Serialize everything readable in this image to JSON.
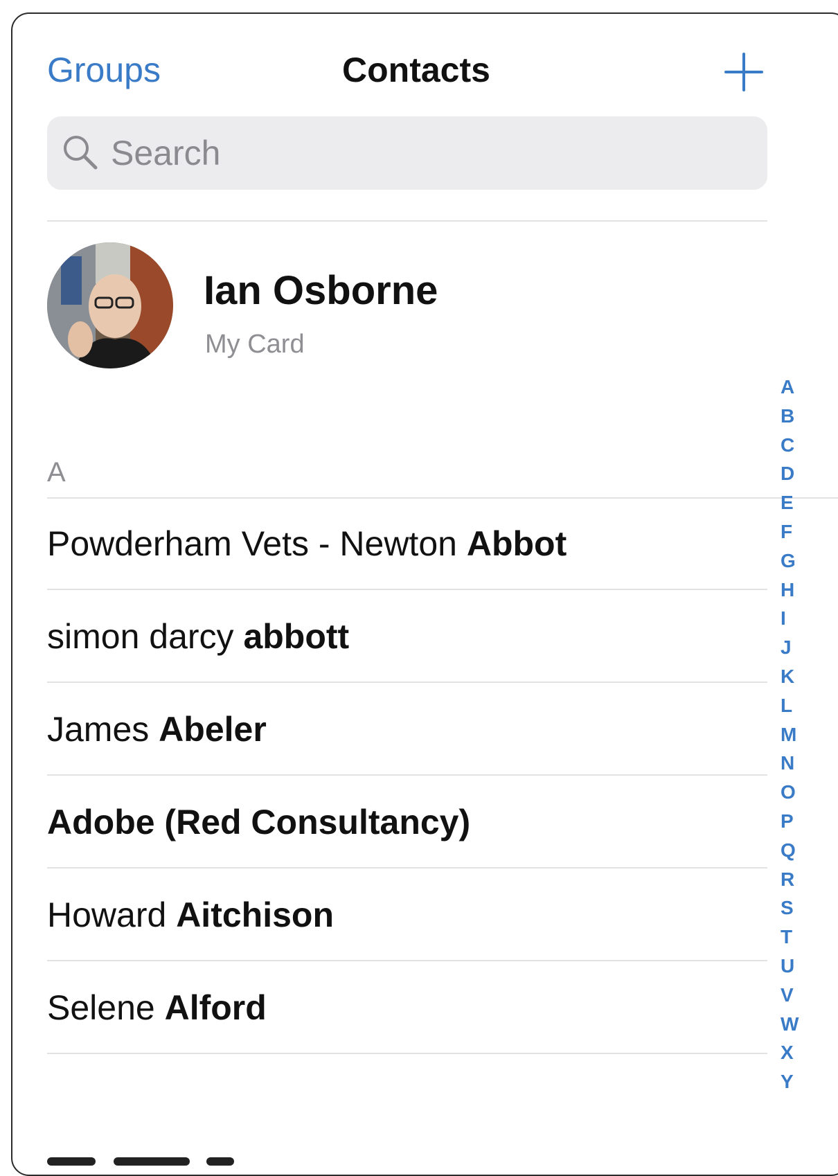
{
  "nav": {
    "groups_label": "Groups",
    "title": "Contacts",
    "add_icon": "plus-icon"
  },
  "search": {
    "placeholder": "Search",
    "value": "",
    "icon": "search-icon"
  },
  "my_card": {
    "name": "Ian Osborne",
    "subtitle": "My Card"
  },
  "sections": [
    {
      "letter": "A",
      "contacts": [
        {
          "first": "Powderham Vets - Newton",
          "last": "Abbot"
        },
        {
          "first": "simon darcy",
          "last": "abbott"
        },
        {
          "first": "James",
          "last": "Abeler"
        },
        {
          "first": "",
          "last": "Adobe (Red Consultancy)"
        },
        {
          "first": "Howard",
          "last": "Aitchison"
        },
        {
          "first": "Selene",
          "last": "Alford"
        }
      ]
    }
  ],
  "index_letters": [
    "A",
    "B",
    "C",
    "D",
    "E",
    "F",
    "G",
    "H",
    "I",
    "J",
    "K",
    "L",
    "M",
    "N",
    "O",
    "P",
    "Q",
    "R",
    "S",
    "T",
    "U",
    "V",
    "W",
    "X",
    "Y"
  ],
  "colors": {
    "accent": "#3a7bc8",
    "secondary_text": "#8e8e93",
    "search_bg": "#ececee",
    "separator": "#e2e2e4"
  }
}
